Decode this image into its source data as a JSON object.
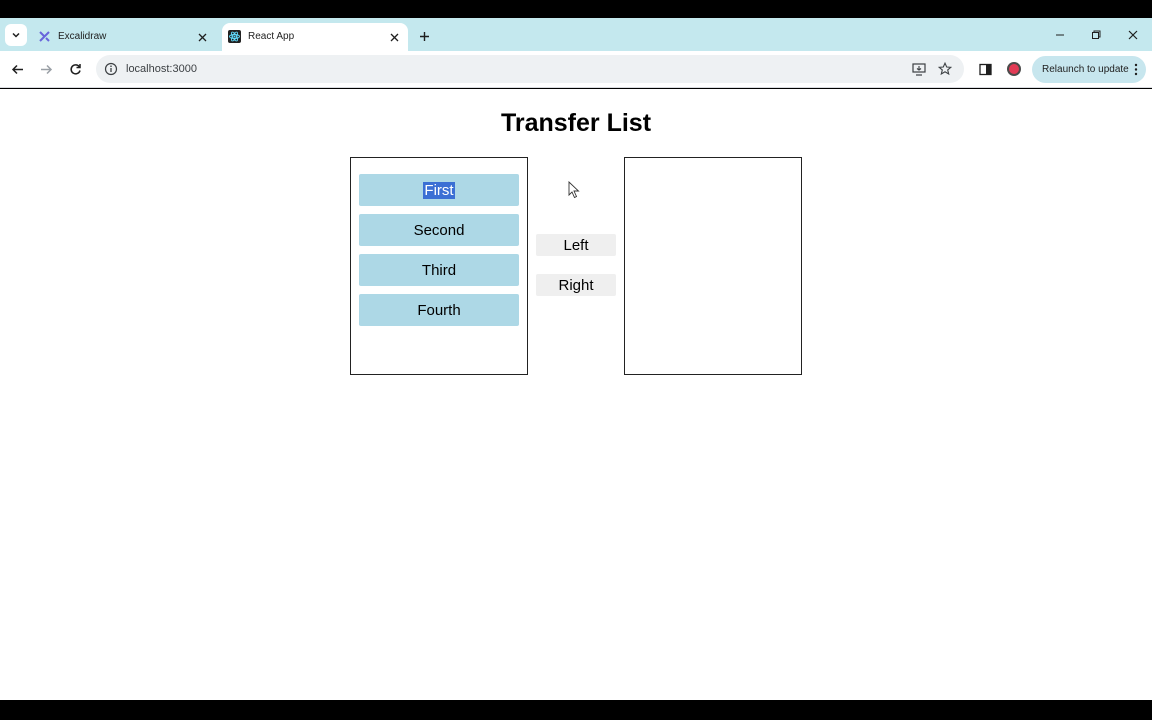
{
  "browser": {
    "tabs": [
      {
        "title": "Excalidraw",
        "active": false,
        "favicon": "excalidraw-icon"
      },
      {
        "title": "React App",
        "active": true,
        "favicon": "react-icon"
      }
    ],
    "url": "localhost:3000",
    "relaunch_label": "Relaunch to update"
  },
  "page": {
    "title": "Transfer List",
    "left_list": [
      {
        "label": "First",
        "selected": true
      },
      {
        "label": "Second",
        "selected": false
      },
      {
        "label": "Third",
        "selected": false
      },
      {
        "label": "Fourth",
        "selected": false
      }
    ],
    "right_list": [],
    "buttons": {
      "left_label": "Left",
      "right_label": "Right"
    }
  },
  "colors": {
    "tabstrip": "#c4e8ee",
    "item_bg": "#add8e6",
    "selection": "#3b6fd4",
    "button_bg": "#efefef"
  }
}
